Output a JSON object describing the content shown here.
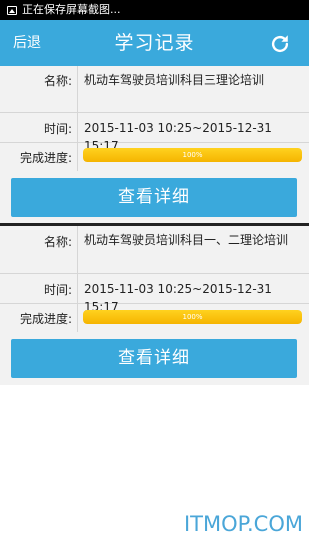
{
  "status_bar": {
    "text": "正在保存屏幕截图..."
  },
  "nav": {
    "back_label": "后退",
    "title": "学习记录",
    "refresh_icon": "refresh-icon"
  },
  "records": [
    {
      "name_label": "名称:",
      "name_value": "机动车驾驶员培训科目三理论培训",
      "time_label": "时间:",
      "time_value": "2015-11-03 10:25~2015-12-31 15:17",
      "progress_label": "完成进度:",
      "progress_value": 1.0,
      "progress_text": "100%",
      "button_label": "查看详细"
    },
    {
      "name_label": "名称:",
      "name_value": "机动车驾驶员培训科目一、二理论培训",
      "time_label": "时间:",
      "time_value": "2015-11-03 10:25~2015-12-31 15:17",
      "progress_label": "完成进度:",
      "progress_value": 1.0,
      "progress_text": "100%",
      "button_label": "查看详细"
    }
  ],
  "watermark": "ITMOP.COM",
  "colors": {
    "accent": "#3aa9dc",
    "progress": "#f5b400",
    "status_bar": "#000000"
  }
}
